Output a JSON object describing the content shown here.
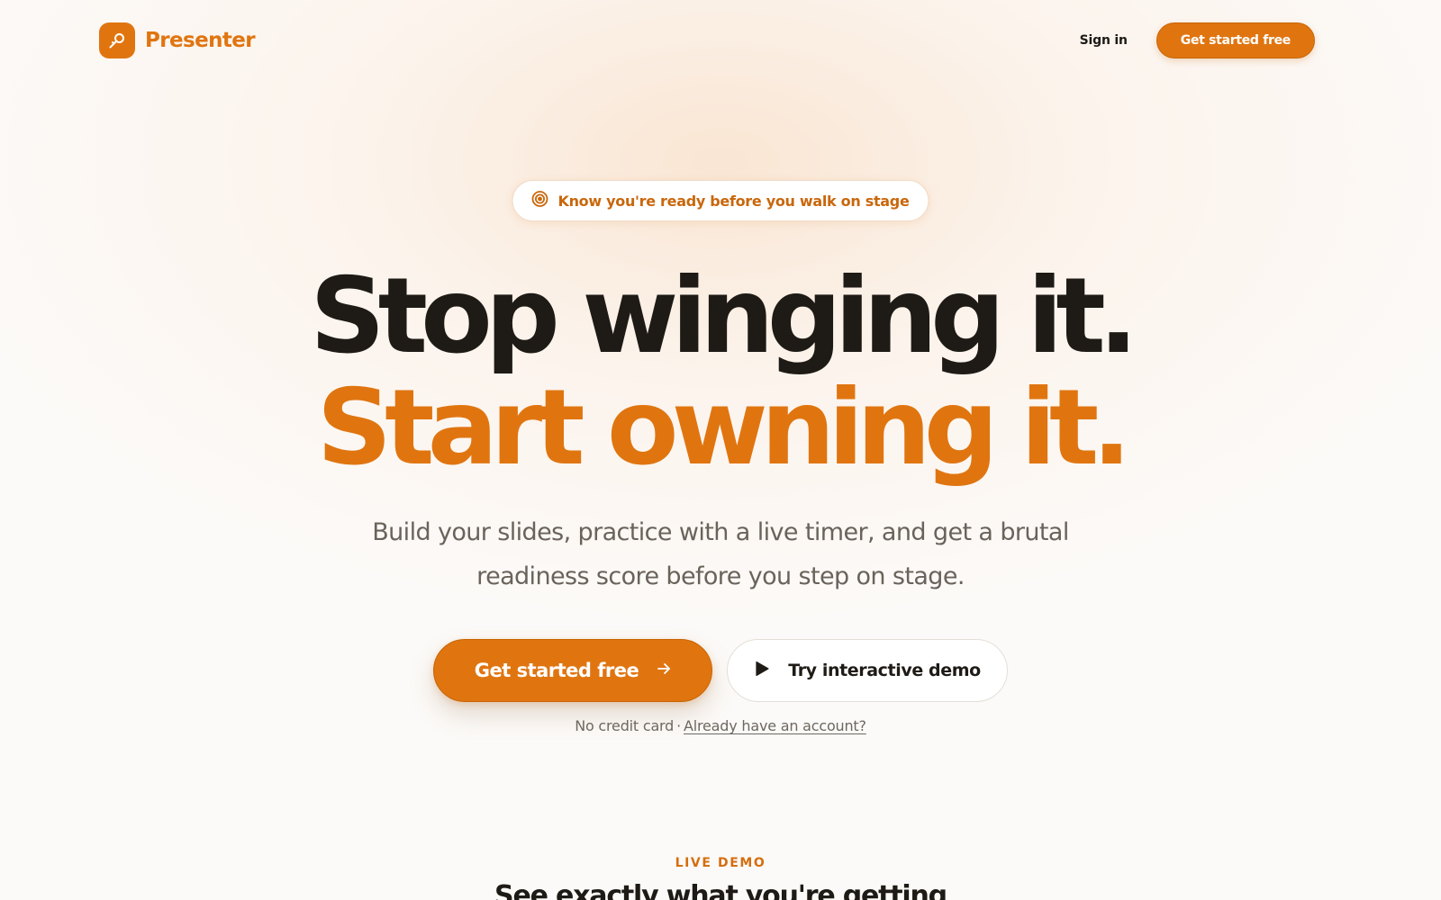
{
  "header": {
    "brand_name": "Presenter",
    "logo_icon": "microphone-icon",
    "sign_in_label": "Sign in",
    "cta_label": "Get started free"
  },
  "hero": {
    "tagline": "Know you're ready before you walk on stage",
    "tagline_icon": "target-icon",
    "headline_line1": "Stop winging it.",
    "headline_line2": "Start owning it.",
    "subheadline": "Build your slides, practice with a live timer, and get a brutal readiness score before you step on stage.",
    "primary_cta_label": "Get started free",
    "primary_cta_icon": "arrow-right-icon",
    "secondary_cta_label": "Try interactive demo",
    "secondary_cta_icon": "play-icon",
    "footnote_text": "No credit card",
    "footnote_separator": "·",
    "footnote_link": "Already have an account?"
  },
  "next_section": {
    "eyebrow": "LIVE DEMO",
    "title": "See exactly what you're getting"
  },
  "colors": {
    "accent": "#e07510",
    "accent_dark": "#c86505",
    "heading": "#1e1a15",
    "body_text": "#6a635b",
    "background": "#fcfaf8"
  }
}
